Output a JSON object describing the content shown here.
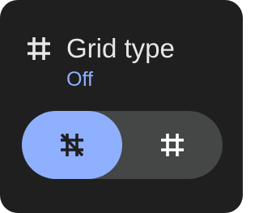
{
  "tile": {
    "icon": "grid-icon",
    "title": "Grid type",
    "value": "Off"
  },
  "options": [
    {
      "name": "grid-off",
      "icon": "grid-off-icon",
      "selected": true
    },
    {
      "name": "grid-on",
      "icon": "grid-icon",
      "selected": false
    }
  ],
  "colors": {
    "background": "#1f1f20",
    "title": "#e7e7e7",
    "accent": "#8fb0ff",
    "track": "#444746",
    "selected_icon": "#1f1f20",
    "unselected_icon": "#ffffff"
  }
}
